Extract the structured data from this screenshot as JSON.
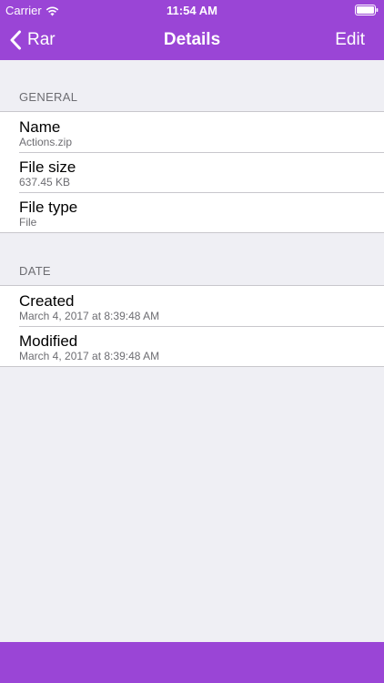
{
  "status_bar": {
    "carrier": "Carrier",
    "time": "11:54 AM",
    "icons": [
      "wifi-icon",
      "battery-icon"
    ]
  },
  "nav": {
    "back_label": "Rar",
    "title": "Details",
    "edit_label": "Edit"
  },
  "sections": {
    "general": {
      "header": "GENERAL",
      "rows": [
        {
          "title": "Name",
          "value": "Actions.zip"
        },
        {
          "title": "File size",
          "value": "637.45 KB"
        },
        {
          "title": "File type",
          "value": "File"
        }
      ]
    },
    "date": {
      "header": "DATE",
      "rows": [
        {
          "title": "Created",
          "value": "March 4, 2017 at 8:39:48 AM"
        },
        {
          "title": "Modified",
          "value": "March 4, 2017 at 8:39:48 AM"
        }
      ]
    }
  },
  "colors": {
    "accent": "#9a45d6",
    "background": "#efeff4",
    "secondary_text": "#6d6d72",
    "separator": "#c8c7cc"
  }
}
